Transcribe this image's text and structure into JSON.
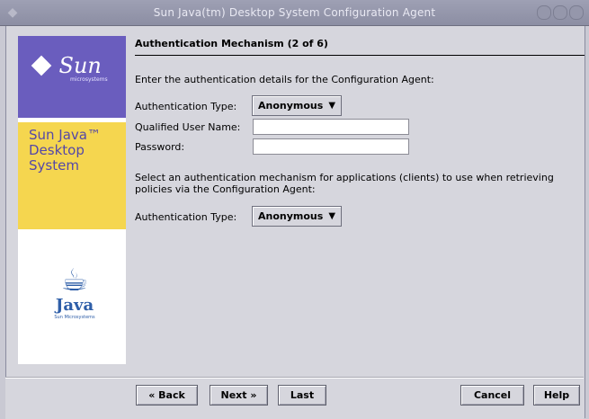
{
  "window": {
    "title": "Sun Java(tm) Desktop System Configuration Agent",
    "icon_names": {
      "window_menu": "window-menu-icon"
    }
  },
  "sidebar": {
    "sun_word": "Sun",
    "sun_sub": "microsystems",
    "product_lines": [
      "Sun Java™",
      "Desktop",
      "System"
    ],
    "java_word": "Java",
    "java_sub": "Sun Microsystems"
  },
  "main": {
    "heading": "Authentication Mechanism (2 of 6)",
    "intro": "Enter the authentication details for the Configuration Agent:",
    "auth_type_label": "Authentication Type:",
    "auth_type_value": "Anonymous",
    "user_label": "Qualified User Name:",
    "user_value": "",
    "password_label": "Password:",
    "password_value": "",
    "clients_line1": "Select an authentication mechanism for applications (clients) to use when retrieving",
    "clients_line2": "policies via the Configuration Agent:",
    "client_auth_type_label": "Authentication Type:",
    "client_auth_type_value": "Anonymous"
  },
  "buttons": {
    "back": "« Back",
    "next": "Next »",
    "last": "Last",
    "cancel": "Cancel",
    "help": "Help"
  }
}
